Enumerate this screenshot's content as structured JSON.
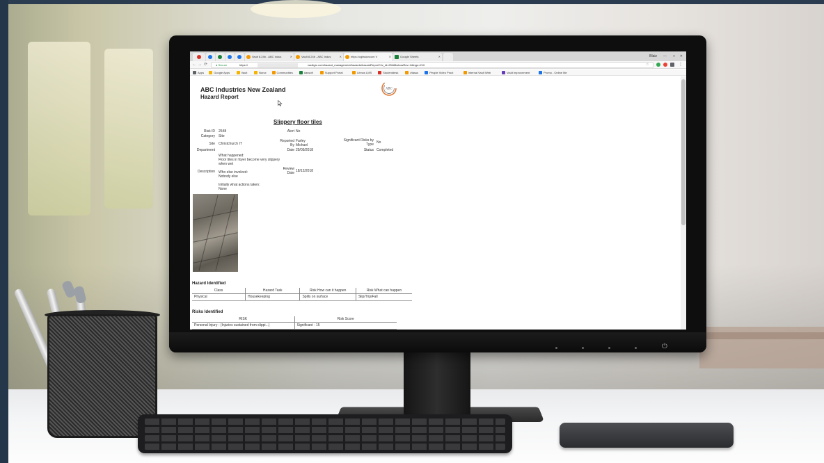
{
  "browser": {
    "tabs": [
      {
        "label": "Vault 8.24b - ABC Indus"
      },
      {
        "label": "Vault 8.24b - ABC Indus"
      },
      {
        "label": "https://cgfasioncom V"
      },
      {
        "label": "Google Sheets"
      }
    ],
    "user_label": "Blaiz",
    "secure_label": "Secure",
    "url_prefix": "https://",
    "url_rest": "vaultgrc.com/hazard_management/hazards/hazardReport?riv_id=2548&showRev=1&lngo=210",
    "bookmarks": [
      {
        "label": "Apps",
        "color": "#5f6368"
      },
      {
        "label": "Google Apps",
        "color": "#f4b400"
      },
      {
        "label": "Vault",
        "color": "#f4b400"
      },
      {
        "label": "Nurux",
        "color": "#f4b400"
      },
      {
        "label": "Communities",
        "color": "#f29900"
      },
      {
        "label": "#assoft",
        "color": "#188038"
      },
      {
        "label": "Support Portal",
        "color": "#f29900"
      },
      {
        "label": "Litmos LMS",
        "color": "#f29900"
      },
      {
        "label": "Studentdesk",
        "color": "#d93025"
      },
      {
        "label": "#tasus",
        "color": "#f29900"
      },
      {
        "label": "People Video Proct",
        "color": "#1a73e8"
      },
      {
        "label": "Internal Vault Web",
        "color": "#f29900"
      },
      {
        "label": "Vault Improvement",
        "color": "#673ab7"
      },
      {
        "label": "Promo - Online Me",
        "color": "#1a73e8"
      }
    ]
  },
  "report": {
    "company": "ABC Industries New Zealand",
    "title": "Hazard Report",
    "logo_text": "ABC",
    "hazard_name": "Slippery floor tiles",
    "fields": {
      "risk_id_label": "Risk ID",
      "risk_id": "2548",
      "alert_label": "Alert",
      "alert": "No",
      "category_label": "Category",
      "category": "Site",
      "site_label": "Site",
      "site": "Christchurch IT",
      "department_label": "Department",
      "reported_by_label": "Reported\nBy",
      "reported_by": "Farley\nMichael",
      "significant_label": "Significant Risks by\nType",
      "significant": "No",
      "date_label": "Date",
      "date": "29/09/2018",
      "status_label": "Status",
      "status": "Completed",
      "description_label": "Description",
      "description": "What happened:\nFloor tiles in foyer become very slippery\nwhen wet\n\nWho else involved:\nNobody else\n\nInitially what actions taken:\nNone",
      "review_label": "Review\nDate",
      "review_date": "18/12/2018"
    },
    "hazard_identified": {
      "title": "Hazard Identified",
      "headers": [
        "Class",
        "Hazard Task",
        "Risk How can it happen",
        "Risk What can happen"
      ],
      "rows": [
        [
          "Physical",
          "Housekeeping",
          "Spills on surface",
          "Slip/Trip/Fall"
        ]
      ]
    },
    "risks_identified": {
      "title": "Risks Identified",
      "headers": [
        "RISK",
        "Risk Score"
      ],
      "rows": [
        [
          "Personal Injury - (Injuries sustained from slippi...)",
          "Significant - 15"
        ]
      ]
    }
  }
}
